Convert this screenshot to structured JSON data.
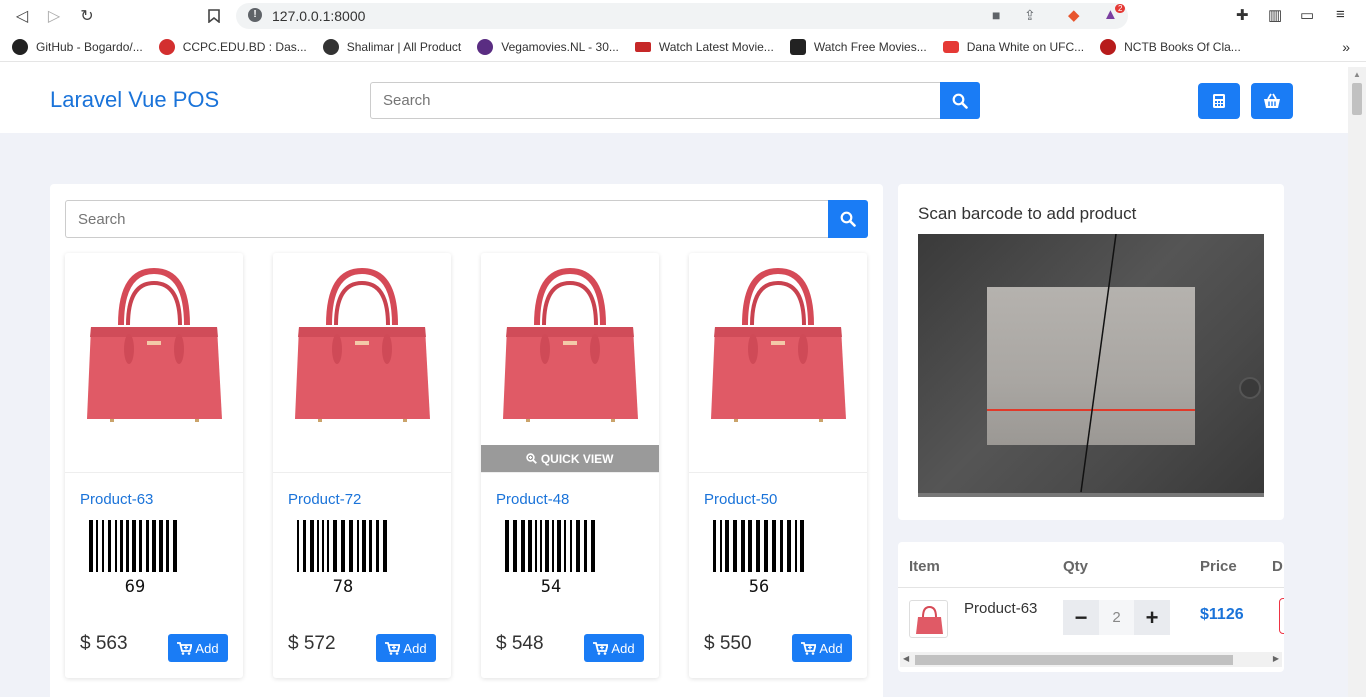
{
  "browser": {
    "url": "127.0.0.1:8000",
    "bookmarks": [
      {
        "label": "GitHub - Bogardo/...",
        "color": "#222"
      },
      {
        "label": "CCPC.EDU.BD : Das...",
        "color": "#d32f2f"
      },
      {
        "label": "Shalimar | All Product",
        "color": "#333"
      },
      {
        "label": "Vegamovies.NL - 30...",
        "color": "#5a2d82"
      },
      {
        "label": "Watch Latest Movie...",
        "color": "#c62828"
      },
      {
        "label": "Watch Free Movies...",
        "color": "#222"
      },
      {
        "label": "Dana White on UFC...",
        "color": "#e53935"
      },
      {
        "label": "NCTB Books Of Cla...",
        "color": "#b71c1c"
      }
    ],
    "more": "»",
    "extension_badge": "2"
  },
  "header": {
    "brand": "Laravel Vue POS",
    "search_placeholder": "Search"
  },
  "products": {
    "search_placeholder": "Search",
    "quick_view_label": "QUICK VIEW",
    "add_label": "Add",
    "items": [
      {
        "name": "Product-63",
        "code": "69",
        "price": "$ 563"
      },
      {
        "name": "Product-72",
        "code": "78",
        "price": "$ 572"
      },
      {
        "name": "Product-48",
        "code": "54",
        "price": "$ 548"
      },
      {
        "name": "Product-50",
        "code": "56",
        "price": "$ 550"
      }
    ]
  },
  "scanner": {
    "title": "Scan barcode to add product"
  },
  "cart": {
    "headers": {
      "item": "Item",
      "qty": "Qty",
      "price": "Price",
      "delete": "D"
    },
    "rows": [
      {
        "name": "Product-63",
        "qty": "2",
        "price": "$1126"
      }
    ]
  },
  "colors": {
    "accent": "#1a7cf5",
    "brand": "#1a73d9",
    "bag": "#e05a66"
  }
}
